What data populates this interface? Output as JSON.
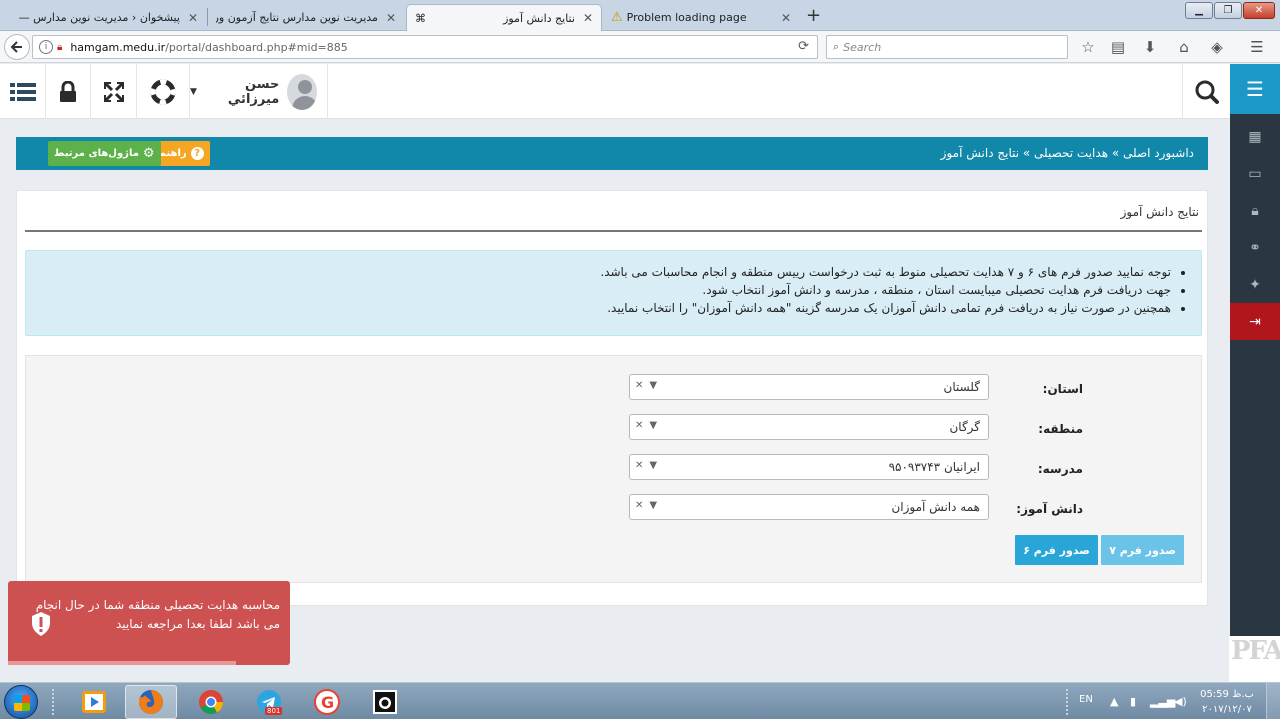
{
  "browser": {
    "tabs": [
      {
        "title": "پیشخوان ‹ مدیریت نوین مدارس —",
        "active": false
      },
      {
        "title": "مدیریت نوین مدارس نتایج آزمون ور",
        "active": false
      },
      {
        "title": "نتایج دانش آموز",
        "active": true
      },
      {
        "title": "Problem loading page",
        "active": false
      }
    ],
    "url_domain": "hamgam.medu.ir",
    "url_path": "/portal/dashboard.php#mid=885",
    "search_placeholder": "Search"
  },
  "header": {
    "user_name": "حسن میرزائي"
  },
  "breadcrumb": {
    "text": "داشبورد اصلی » هدایت تحصیلی » نتایج دانش آموز",
    "help_label": "راهنما",
    "modules_label": "ماژول‌های مرتبط"
  },
  "panel": {
    "title": "نتایج دانش آموز",
    "notes": [
      "توجه نمایید صدور فرم های ۶ و ۷ هدایت تحصیلی منوط به ثبت درخواست رییس منطقه و انجام محاسبات می باشد.",
      "جهت دریافت فرم هدایت تحصیلی میبایست استان ، منطقه ، مدرسه و دانش آموز انتخاب شود.",
      "همچنین در صورت نیاز به دریافت فرم تمامی دانش آموزان یک مدرسه گزینه \"همه دانش آموزان\" را انتخاب نمایید."
    ]
  },
  "form": {
    "province_label": "استان:",
    "province_value": "گلستان",
    "region_label": "منطقه:",
    "region_value": "گرگان",
    "school_label": "مدرسه:",
    "school_value": "ایرانیان ۹۵۰۹۳۷۴۳",
    "student_label": "دانش آموز:",
    "student_value": "همه دانش آموزان",
    "btn_form7": "صدور فرم ۷",
    "btn_form6": "صدور فرم ۶"
  },
  "toast": {
    "message": "محاسبه هدایت تحصیلی منطقه شما در حال انجام می باشد لطفا بعدا مراجعه نمایید"
  },
  "watermark": "PFA",
  "taskbar": {
    "lang": "EN",
    "time": "05:59 ب.ظ",
    "date": "۲۰۱۷/۱۲/۰۷",
    "telegram_badge": "801"
  },
  "colors": {
    "accent_blue": "#1187aa",
    "sidebar_active": "#1b98c8",
    "danger": "#b0161b",
    "help_orange": "#f5a623",
    "modules_green": "#5db14a",
    "toast_red": "#cd5150"
  }
}
